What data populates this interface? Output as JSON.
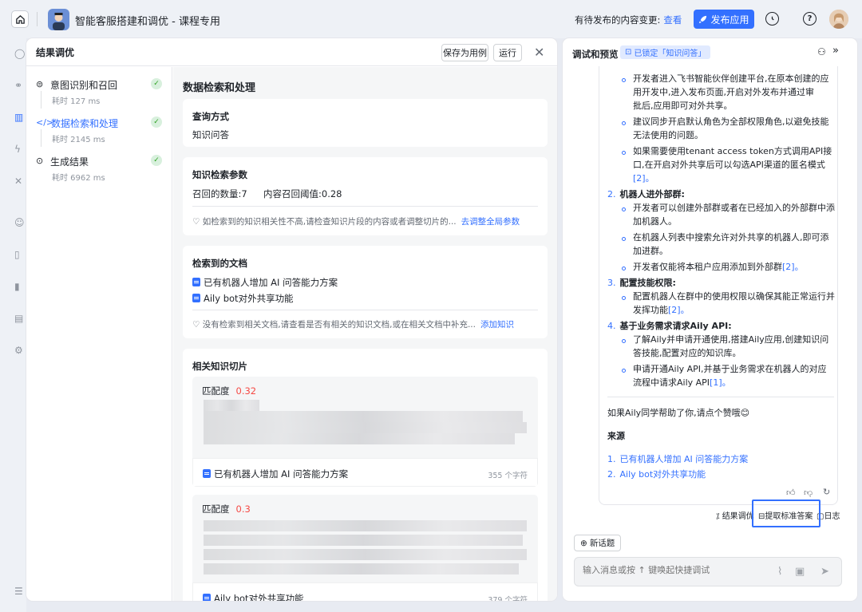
{
  "topbar": {
    "app_title": "智能客服搭建和调优 - 课程专用",
    "pending_text": "有待发布的内容变更:",
    "pending_link": "查看",
    "publish_label": "发布应用"
  },
  "panel": {
    "title": "结果调优",
    "save_case_label": "保存为用例",
    "run_label": "运行"
  },
  "steps": [
    {
      "label": "意图识别和召回",
      "time": "耗时 127 ms"
    },
    {
      "label": "数据检索和处理",
      "time": "耗时 2145 ms"
    },
    {
      "label": "生成结果",
      "time": "耗时 6962 ms"
    }
  ],
  "content": {
    "title": "数据检索和处理",
    "query_card": {
      "title": "查询方式",
      "value": "知识问答"
    },
    "params_card": {
      "title": "知识检索参数",
      "recall_count": "召回的数量:7",
      "threshold": "内容召回阈值:0.28",
      "tip": "如检索到的知识相关性不高,请检查知识片段的内容或者调整切片的...",
      "tip_link": "去调整全局参数"
    },
    "docs_card": {
      "title": "检索到的文档",
      "docs": [
        "已有机器人增加 AI 问答能力方案",
        "Aily bot对外共享功能"
      ],
      "tip": "没有检索到相关文档,请查看是否有相关的知识文档,或在相关文档中补充...",
      "tip_link": "添加知识"
    },
    "slices_card": {
      "title": "相关知识切片",
      "slices": [
        {
          "score_label": "匹配度",
          "score": "0.32",
          "doc": "已有机器人增加 AI 问答能力方案",
          "chars": "355 个字符"
        },
        {
          "score_label": "匹配度",
          "score": "0.3",
          "doc": "Aily bot对外共享功能",
          "chars": "379 个字符"
        }
      ]
    }
  },
  "right": {
    "title": "调试和预览",
    "locked_label": "已锁定「知识问答」",
    "answer": {
      "b1": "开发者进入飞书智能伙伴创建平台,在原本创建的应",
      "b1b": "用开发中,进入发布页面,开启对外发布并通过审",
      "b1c": "批后,应用即可对外共享。",
      "b2": "建议同步开启默认角色为全部权限角色,以避免技能",
      "b2b": "无法使用的问题。",
      "b3": "如果需要使用tenant access token方式调用API接",
      "b3b": "口,在开启对外共享后可以勾选API渠道的匿名模式",
      "b3c": "[2]。",
      "s2": "机器人进外部群:",
      "s2_b1": "开发者可以创建外部群或者在已经加入的外部群中添",
      "s2_b1b": "加机器人。",
      "s2_b2": "在机器人列表中搜索允许对外共享的机器人,即可添",
      "s2_b2b": "加进群。",
      "s2_b3": "开发者仅能将本租户应用添加到外部群",
      "s2_b3ref": "[2]。",
      "s3": "配置技能权限:",
      "s3_b1": "配置机器人在群中的使用权限以确保其能正常运行并",
      "s3_b1b": "发挥功能",
      "s3_b1ref": "[2]。",
      "s4": "基于业务需求请求Aily API:",
      "s4_b1": "了解Aily并申请开通使用,搭建Aily应用,创建知识问",
      "s4_b1b": "答技能,配置对应的知识库。",
      "s4_b2": "申请开通Aily API,并基于业务需求在机器人的对应",
      "s4_b2b": "流程中请求Aily API",
      "s4_b2ref": "[1]。",
      "feedback": "如果Aily同学帮助了你,请点个赞哦😊",
      "sources_title": "来源",
      "sources": [
        "已有机器人增加 AI 问答能力方案",
        "Aily bot对外共享功能"
      ]
    },
    "actions": {
      "tune": "结果调优",
      "extract": "提取标准答案",
      "log": "日志"
    },
    "new_topic": "新话题",
    "input_placeholder": "输入消息或按 ↑ 键唤起快捷调试"
  }
}
